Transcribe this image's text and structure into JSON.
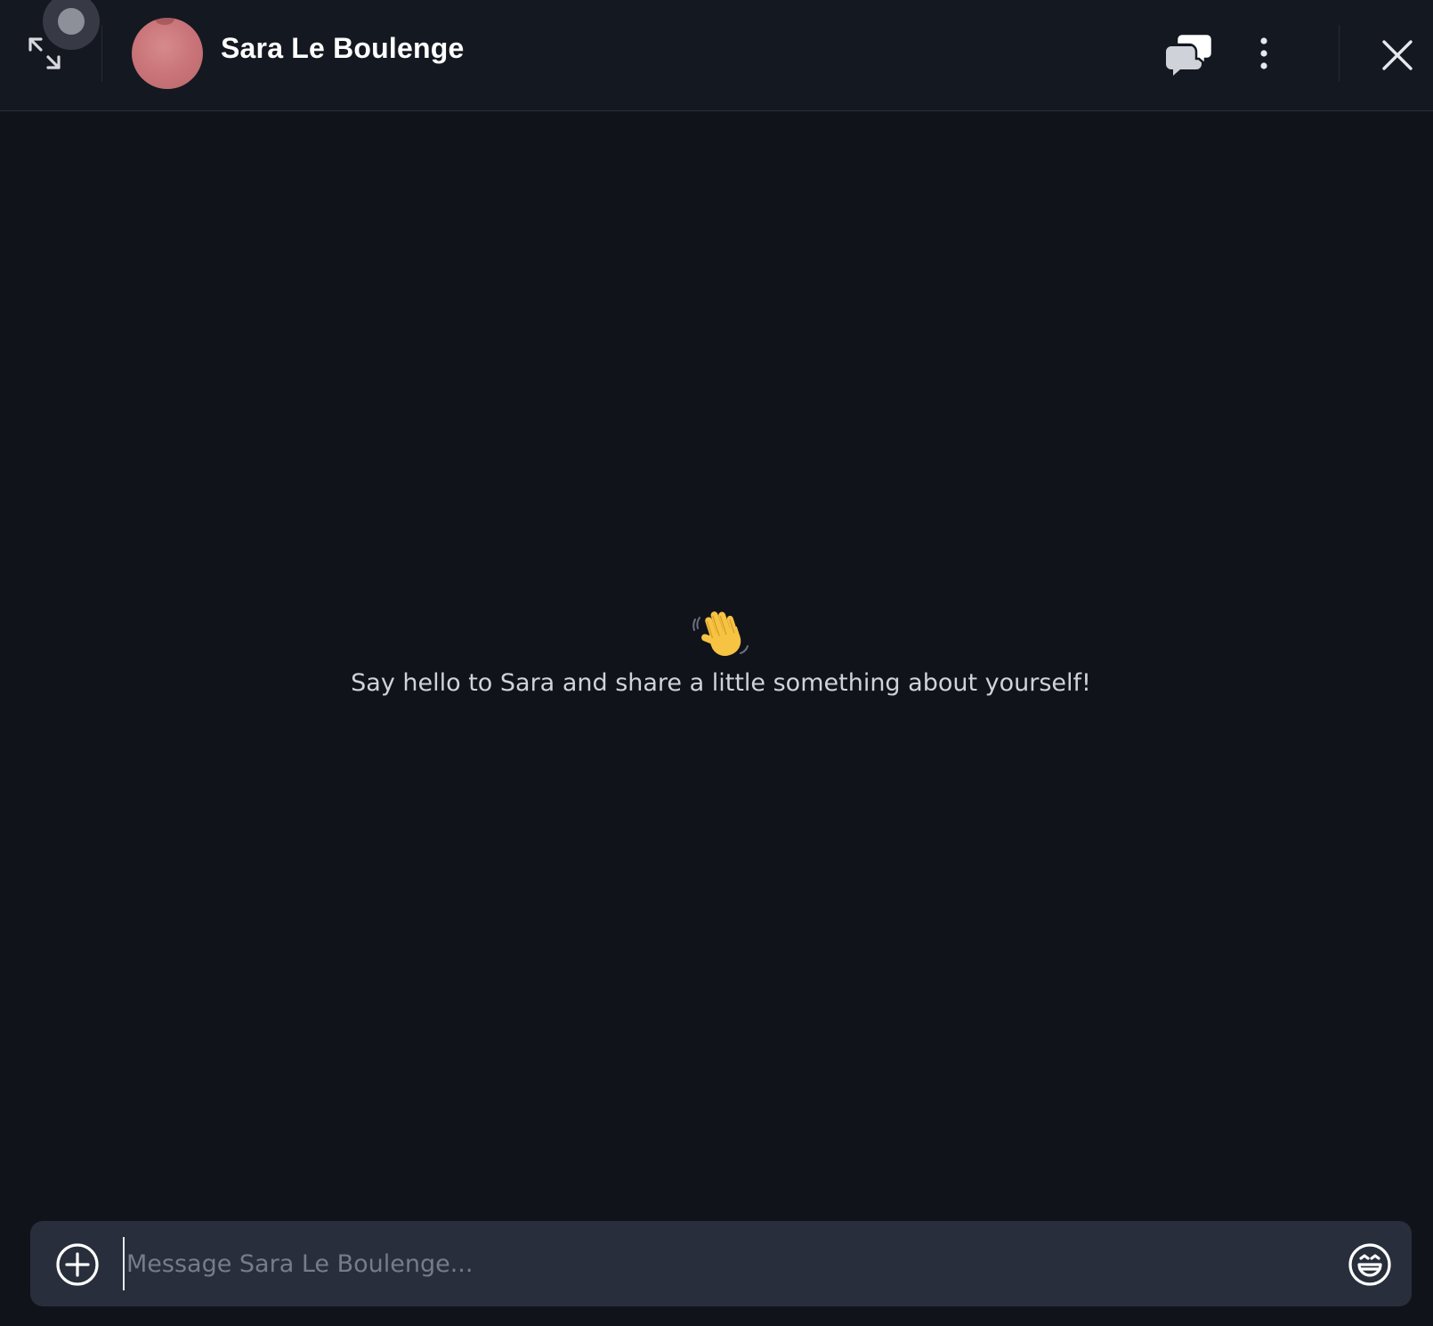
{
  "header": {
    "contact_name": "Sara Le Boulenge"
  },
  "empty_state": {
    "message": "Say hello to Sara and share a little something about yourself!",
    "icon": "waving-hand-icon"
  },
  "composer": {
    "placeholder": "Message Sara Le Boulenge...",
    "value": ""
  },
  "icons": {
    "expand": "expand-icon",
    "threads": "threads-icon",
    "more": "more-vertical-icon",
    "close": "close-icon",
    "attach": "plus-circle-icon",
    "emoji": "emoji-icon"
  },
  "colors": {
    "background": "#11131b",
    "header": "#141821",
    "composer": "#282e3b",
    "text": "#ffffff",
    "muted_text": "#767c89"
  }
}
